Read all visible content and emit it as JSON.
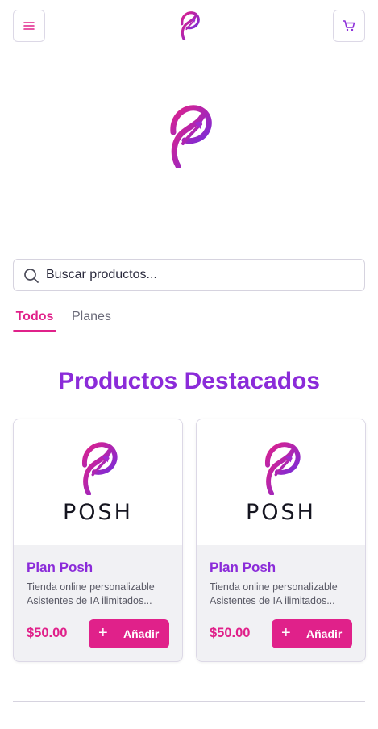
{
  "header": {
    "menu_icon": "hamburger-menu-icon",
    "logo_icon": "posh-p-logo",
    "cart_icon": "shopping-cart-icon"
  },
  "hero": {
    "logo_icon": "posh-p-logo"
  },
  "search": {
    "icon": "search-icon",
    "placeholder": "Buscar productos..."
  },
  "tabs": [
    {
      "label": "Todos",
      "active": true
    },
    {
      "label": "Planes",
      "active": false
    }
  ],
  "section": {
    "title": "Productos Destacados"
  },
  "products": [
    {
      "image_wordmark": "POSH",
      "name": "Plan Posh",
      "description_lines": [
        "Tienda online personalizable",
        "Asistentes de IA ilimitados..."
      ],
      "price": "$50.00",
      "add_label": "Añadir",
      "add_icon": "plus-icon"
    },
    {
      "image_wordmark": "POSH",
      "name": "Plan Posh",
      "description_lines": [
        "Tienda online personalizable",
        "Asistentes de IA ilimitados..."
      ],
      "price": "$50.00",
      "add_label": "Añadir",
      "add_icon": "plus-icon"
    }
  ],
  "colors": {
    "accent_pink": "#e0218a",
    "accent_purple": "#8b2bd9",
    "border": "#dcd8e6"
  }
}
